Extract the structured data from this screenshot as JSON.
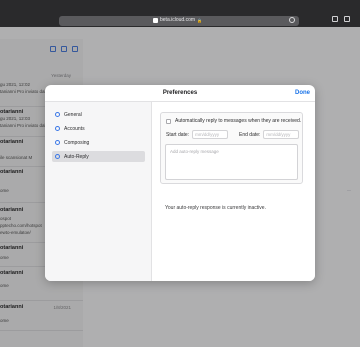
{
  "browser": {
    "url": "beta.icloud.com"
  },
  "mail_list": {
    "items": [
      {
        "sender": "",
        "date": "Yesterday",
        "lines": [
          "gu 2021, 12:02",
          "tanianni Pro inviato dal"
        ]
      },
      {
        "sender": "otarianni",
        "date": "",
        "lines": [
          "gu 2021, 12:03",
          "tanianni Pro inviato dal"
        ]
      },
      {
        "sender": "otarianni",
        "date": "",
        "lines": [
          "ile scansionat M"
        ]
      },
      {
        "sender": "otarianni",
        "date": "",
        "lines": [
          "ome"
        ]
      },
      {
        "sender": "otarianni",
        "date": "",
        "lines": [
          "ospot",
          "pptecho.com/hotspot",
          "ewto-emulatoe/"
        ]
      },
      {
        "sender": "otarianni",
        "date": "",
        "lines": [
          "ome"
        ]
      },
      {
        "sender": "otarianni",
        "date": "",
        "lines": [
          "ome"
        ]
      },
      {
        "sender": "otarianni",
        "date": "1/8/2021",
        "lines": [
          "ome"
        ]
      }
    ]
  },
  "modal": {
    "title": "Preferences",
    "done_label": "Done",
    "nav": [
      {
        "label": "General",
        "icon": "gear-icon"
      },
      {
        "label": "Accounts",
        "icon": "at-icon"
      },
      {
        "label": "Composing",
        "icon": "pencil-icon"
      },
      {
        "label": "Auto-Reply",
        "icon": "plane-icon",
        "active": true
      }
    ],
    "auto_reply": {
      "checkbox_label": "Automatically reply to messages when they are received.",
      "checked": false,
      "start_label": "Start date:",
      "start_placeholder": "mm/dd/yyyy",
      "end_label": "End date:",
      "end_placeholder": "mm/dd/yyyy",
      "message_placeholder": "Add auto-reply message",
      "status_text": "Your auto-reply response is currently inactive."
    }
  },
  "colors": {
    "accent": "#1a73e8",
    "chrome": "#2a2a2c"
  }
}
